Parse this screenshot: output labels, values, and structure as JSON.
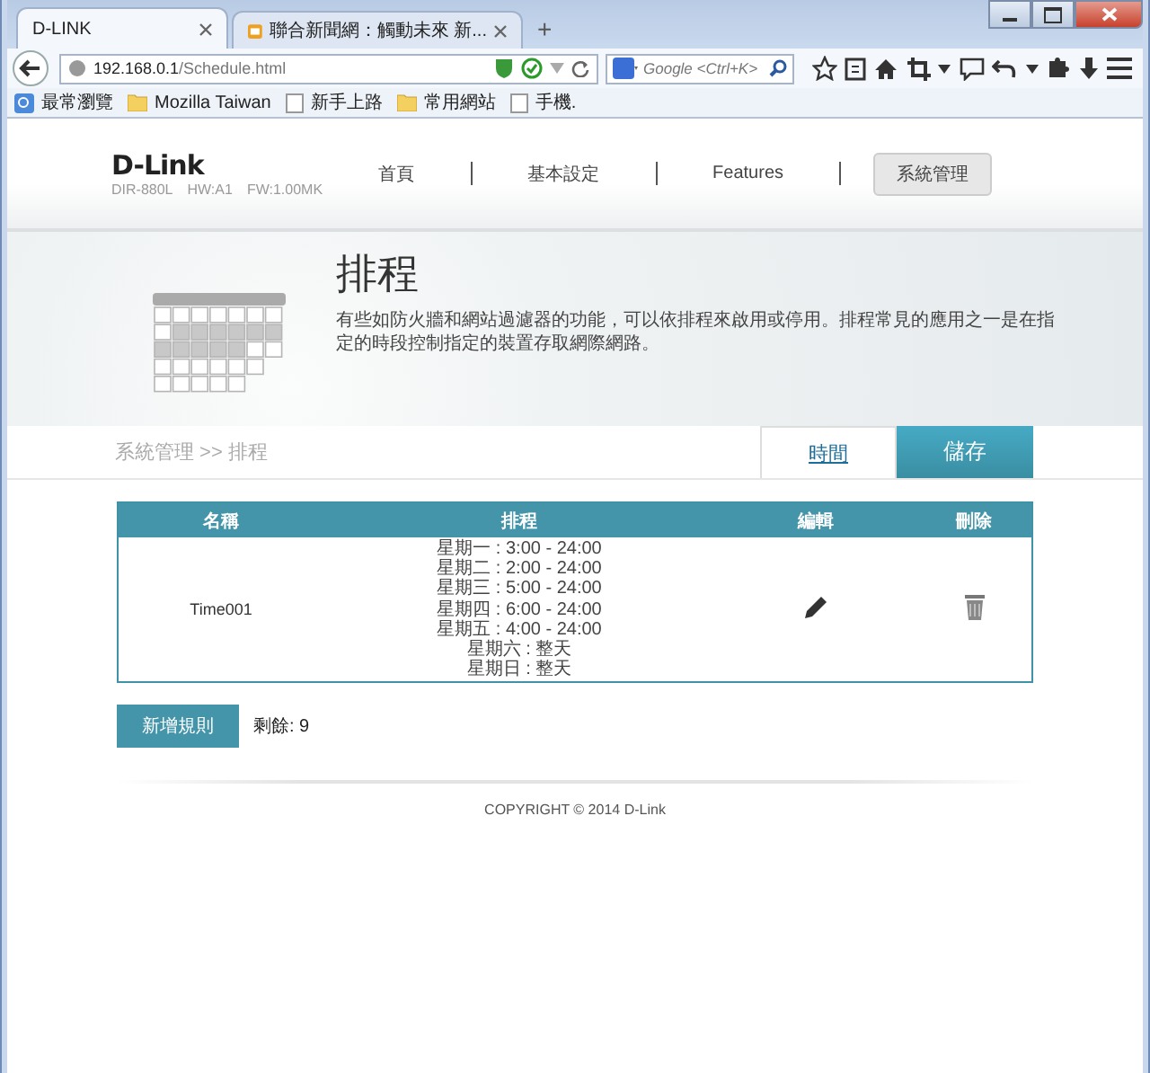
{
  "browser": {
    "tabs": [
      {
        "title": "D-LINK",
        "selected": true,
        "kind": "plain"
      },
      {
        "title": "聯合新聞網：觸動未來 新...",
        "selected": false,
        "kind": "news"
      }
    ],
    "new_tab": "+",
    "address": {
      "host": "192.168.0.1",
      "path": "/Schedule.html"
    },
    "search": {
      "placeholder": "Google <Ctrl+K>"
    },
    "bookmarks": [
      {
        "label": "最常瀏覽",
        "kind": "feed"
      },
      {
        "label": "Mozilla Taiwan",
        "kind": "folder"
      },
      {
        "label": "新手上路",
        "kind": "page"
      },
      {
        "label": "常用網站",
        "kind": "folder"
      },
      {
        "label": "手機.",
        "kind": "page"
      }
    ]
  },
  "page": {
    "brand": {
      "logo": "D-Link",
      "model": "DIR-880L",
      "hw": "HW:A1",
      "fw": "FW:1.00MK"
    },
    "nav": [
      {
        "label": "首頁",
        "selected": false
      },
      {
        "label": "基本設定",
        "selected": false
      },
      {
        "label": "Features",
        "selected": false
      },
      {
        "label": "系統管理",
        "selected": true
      }
    ],
    "banner": {
      "title": "排程",
      "description": "有些如防火牆和網站過濾器的功能，可以依排程來啟用或停用。排程常見的應用之一是在指定的時段控制指定的裝置存取網際網路。"
    },
    "breadcrumb": "系統管理 >> 排程",
    "actions": [
      {
        "label": "時間",
        "kind": "link"
      },
      {
        "label": "儲存",
        "kind": "primary"
      }
    ],
    "table": {
      "columns": [
        "名稱",
        "排程",
        "編輯",
        "刪除"
      ],
      "rows": [
        {
          "name": "Time001",
          "schedule": [
            "星期一 : 3:00 - 24:00",
            "星期二 : 2:00 - 24:00",
            "星期三 : 5:00 - 24:00",
            "星期四 : 6:00 - 24:00",
            "星期五 : 4:00 - 24:00",
            "星期六 : 整天",
            "星期日 : 整天"
          ]
        }
      ]
    },
    "add_button": "新增規則",
    "remaining": "剩餘: 9",
    "copyright": "COPYRIGHT © 2014 D-Link"
  }
}
